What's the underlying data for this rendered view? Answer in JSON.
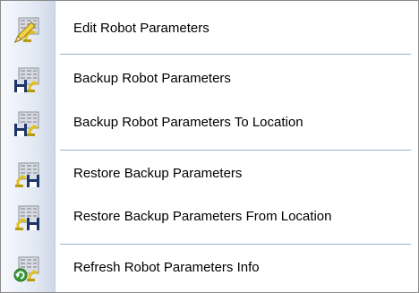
{
  "menu": {
    "items": [
      {
        "label": "Edit Robot Parameters",
        "icon": "edit-parameters-icon"
      },
      {
        "label": "Backup Robot Parameters",
        "icon": "backup-parameters-icon"
      },
      {
        "label": "Backup Robot Parameters To Location",
        "icon": "backup-to-location-icon"
      },
      {
        "label": "Restore Backup Parameters",
        "icon": "restore-parameters-icon"
      },
      {
        "label": "Restore Backup Parameters From Location",
        "icon": "restore-from-location-icon"
      },
      {
        "label": "Refresh Robot Parameters Info",
        "icon": "refresh-parameters-icon"
      }
    ]
  },
  "colors": {
    "separator": "#9bb0d6",
    "gutter": "#dfe6f2",
    "robot_yellow": "#e0c020",
    "floppy_blue": "#1c3668",
    "refresh_green": "#3a9a3a"
  }
}
